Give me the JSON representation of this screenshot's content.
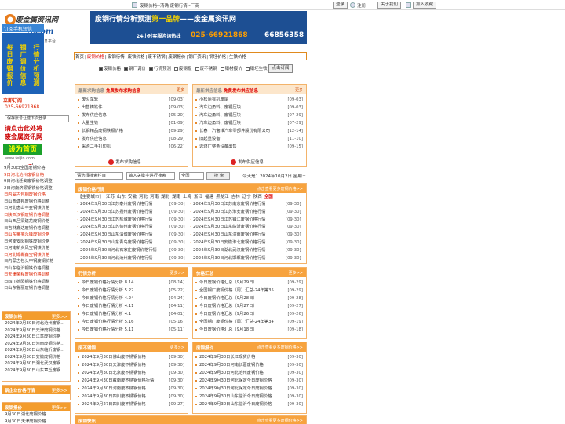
{
  "topbar": {
    "title": "废钢价格--清确 废钢行情--厂商",
    "login": "登录",
    "register": "注册",
    "about": "关于我们",
    "favorite": "加入收藏"
  },
  "logo": {
    "line1": "废金属资讯网",
    "line2": "s.com",
    "line3": "属信息平台"
  },
  "banner": {
    "line1_a": "废钢行情分析预测",
    "line1_hl": "第一品牌",
    "line1_b": "——废金属资讯网",
    "sub": "24小时客服咨询热线",
    "phone1": "025-66921868",
    "phone2": "66856358"
  },
  "float_left": {
    "head": "订阅手机短信",
    "col1": "每日废钢报价",
    "col2": "钢厂调价信息",
    "col3": "行情分析预测",
    "sub": "立即订阅",
    "phone": "025-66921868",
    "save": "保存账号让健下次登录",
    "ad1": "请点击此处将",
    "ad2": "废金属资讯网",
    "ad3": "设为首页",
    "url": "www.feijin.com",
    "close": "关闭"
  },
  "nav": {
    "items": [
      "首页",
      "废钢价格",
      "废钢行情",
      "废铁价格",
      "废不锈钢",
      "废钢报价",
      "钢厂资讯",
      "钢坯价格",
      "生铁价格"
    ]
  },
  "checks": {
    "items": [
      "废钢价格",
      "钢厂调价",
      "行情预测",
      "废钢报",
      "废不锈钢",
      "钢材报价",
      "钢坯生铁"
    ],
    "subscribe": "点击订阅"
  },
  "left_list": {
    "items": [
      "9月30日全国废钢价格",
      "9日河北沧州废钢价格",
      "9日河北迁安废钢价格调整",
      "2日河南济源钢铁价格调整",
      "日内蒙古包钢废钢价格",
      "日山西建邦废钢价格调整",
      "日河北唐山丰亚钢铁价格",
      "日陕西汉钢废钢价格调整",
      "日山西吕梁建龙废钢价格",
      "日吉林鑫达废钢价格调整",
      "日山东莱芜永锋废钢价格",
      "日河南安阳钢铁废钢价格",
      "日河南新乡凤宝钢铁价格",
      "日河北邯郸鑫宝钢铁价格",
      "日内蒙古包头申钢废钢价格",
      "日山东临沂钢铁价格调整",
      "日天津荣程废钢价格调整",
      "日四川德阳钢铁价格调整",
      "日山东鲁丽废钢价格调整"
    ]
  },
  "left_price": {
    "title": "废钢价格",
    "more": "更多>>",
    "items": [
      "2024年9月30日河北沧州废钢...",
      "2024年9月30日天津废钢价格",
      "2024年9月30日江苏废钢价格",
      "2024年9月30日河南废钢价格...",
      "2024年9月30日山东临沂废钢...",
      "2024年9月30日安徽废钢价格",
      "2024年9月30日湖北武汉废钢...",
      "2024年9月30日山东章丘废钢..."
    ]
  },
  "left_mill": {
    "title": "钢企业价格行情",
    "more": "更多>>"
  },
  "left_news": {
    "title": "废钢报价",
    "more": "更多>>",
    "items": [
      "9月30日湖北废钢价格",
      "9月30日天津废钢价格"
    ]
  },
  "buy": {
    "title": "最新求购信息",
    "free": "免费发布求购信息",
    "more": "更多",
    "items": [
      [
        "废火车轮",
        "09-03"
      ],
      [
        "出售铸铁件",
        "09-03"
      ],
      [
        "发布供应信息",
        "05-20"
      ],
      [
        "大量生铁",
        "01-09"
      ],
      [
        "长钢精品废钢铁报价格",
        "09-29"
      ],
      [
        "发布供应信息",
        "08-29"
      ],
      [
        "采购二手打印机",
        "06-22"
      ]
    ],
    "post": "发布求购信息"
  },
  "supply": {
    "title": "最新供应信息",
    "free": "免费发布供应信息",
    "more": "更多",
    "items": [
      [
        "小松原有机废尾",
        "09-03"
      ],
      [
        "汽车边角料、废钢压块",
        "09-03"
      ],
      [
        "汽车边角料、废钢压块",
        "07-29"
      ],
      [
        "汽车边角料、废钢压块",
        "07-29"
      ],
      [
        "长春一汽富维汽车零部件股份有限公司",
        "12-14"
      ],
      [
        "旧起重设备",
        "11-10"
      ],
      [
        "选煤厂整条设备出售",
        "09-15"
      ]
    ],
    "post": "发布供应信息"
  },
  "search": {
    "type": "请选择搜索栏目",
    "keyword": "输入关键字进行搜索",
    "scope": "全国",
    "btn": "搜 索",
    "today": "今天是：2024年10月2日  星期三"
  },
  "region": {
    "title": "废钢价格行情",
    "more": "点击查看更多废钢价格>>",
    "cities_label": "【主要城市】",
    "cities": [
      "江苏",
      "山东",
      "安徽",
      "河北",
      "河南",
      "湖北",
      "湖南",
      "上海",
      "浙江",
      "福建",
      "黑龙江",
      "吉林",
      "辽宁",
      "陕西",
      "全国"
    ],
    "rows": [
      [
        "2024年9月30日江苏泰州废钢价格行情",
        "09-30",
        "2024年9月30日江苏南京废钢价格行情",
        "09-30"
      ],
      [
        "2024年9月30日江苏扬州废钢价格行情",
        "09-30",
        "2024年9月30日江苏淮安废钢价格行情",
        "09-30"
      ],
      [
        "2024年9月30日江苏盐城废钢价格行情",
        "09-30",
        "2024年9月30日江苏镇江废钢价格行情",
        "09-30"
      ],
      [
        "2024年9月30日江苏徐州废钢价格行情",
        "09-30",
        "2024年9月30日山东临沂废钢价格行情",
        "09-30"
      ],
      [
        "2024年9月30日山东淄博废钢价格行情",
        "09-30",
        "2024年9月30日山东济南废钢价格行情",
        "09-30"
      ],
      [
        "2024年9月30日山东青岛废钢价格行情",
        "09-30",
        "2024年9月30日安徽淮北废钢价格行情",
        "09-30"
      ],
      [
        "2024年9月30日河北石家庄废钢价格行情",
        "09-30",
        "2024年9月30日湖北武汉废钢价格行情",
        "09-30"
      ],
      [
        "2024年9月30日河北沧州废钢价格行情",
        "09-30",
        "2024年9月30日河北邯郸废钢价格行情",
        "09-30"
      ]
    ]
  },
  "analysis": {
    "title": "行情分析",
    "more": "更多>>",
    "items": [
      [
        "今日废钢价格行情分析 8.14",
        "08-14"
      ],
      [
        "今日废钢价格行情分析 5.22",
        "05-22"
      ],
      [
        "今日废钢价格行情分析 4.24",
        "04-24"
      ],
      [
        "今日废钢价格行情分析 4.11",
        "04-11"
      ],
      [
        "今日废钢价格行情分析 4.1",
        "04-01"
      ],
      [
        "今日废钢价格行情分析 5.16",
        "05-16"
      ],
      [
        "今日废钢价格行情分析 5.11",
        "05-11"
      ]
    ]
  },
  "adjust": {
    "title": "价格汇总",
    "more": "更多>>",
    "items": [
      [
        "今日废钢价格汇总（9月29日）",
        "09-29"
      ],
      [
        "全国钢厂废钢价格（周）汇总-24年第35",
        "09-29"
      ],
      [
        "今日废钢价格汇总（9月28日）",
        "09-28"
      ],
      [
        "今日废钢价格汇总（9月27日）",
        "09-27"
      ],
      [
        "今日废钢价格汇总（9月26日）",
        "09-26"
      ],
      [
        "全国钢厂废钢价格（周）汇总-24年第34",
        "09-19"
      ],
      [
        "今日废钢价格汇总（9月18日）",
        "09-18"
      ]
    ]
  },
  "stainless": {
    "title": "废不锈钢",
    "more": "更多>>",
    "items": [
      [
        "2024年9月30日佛山废不锈钢价格",
        "09-30"
      ],
      [
        "2024年9月30日天津废不锈钢价格",
        "09-30"
      ],
      [
        "2024年9月30日北京废不锈钢价格",
        "09-30"
      ],
      [
        "2024年9月30日戴南废不锈钢价格行情",
        "09-30"
      ],
      [
        "2024年9月30日河南废不锈钢价格",
        "09-30"
      ],
      [
        "2024年9月30日四川废不锈钢价格",
        "09-30"
      ],
      [
        "2024年9月27日四川废不锈钢价格",
        "09-27"
      ]
    ]
  },
  "billet": {
    "title": "废钢报价",
    "more": "点击查看更多废钢价格>>",
    "items": [
      [
        "2024年9月30日长江现货价格",
        "09-30"
      ],
      [
        "2024年9月30日河南长葛废钢价格",
        "09-30"
      ],
      [
        "2024年9月30日河北沧州废钢价格",
        "09-30"
      ],
      [
        "2024年9月30日河北保定今日废钢价格",
        "09-30"
      ],
      [
        "2024年9月30日河北保定今日废钢价格",
        "09-30"
      ],
      [
        "2024年9月30日山东临沂今日废钢价格",
        "09-30"
      ],
      [
        "2024年9月30日山东临沂今日废钢价格",
        "09-30"
      ]
    ]
  },
  "bottom": {
    "left": "废钢快讯",
    "right": "点击查看更多废钢价格>>"
  }
}
